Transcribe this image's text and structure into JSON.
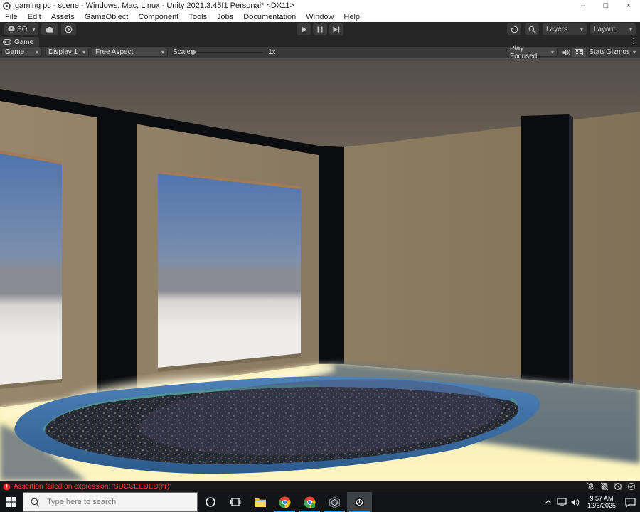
{
  "window": {
    "title": "gaming pc - scene - Windows, Mac, Linux - Unity 2021.3.45f1 Personal* <DX11>",
    "controls": {
      "minimize": "–",
      "maximize": "□",
      "close": "×"
    }
  },
  "glyphs": {
    "caret": "▾",
    "kebab": "⋮"
  },
  "menu_bar": {
    "items": [
      "File",
      "Edit",
      "Assets",
      "GameObject",
      "Component",
      "Tools",
      "Jobs",
      "Documentation",
      "Window",
      "Help"
    ]
  },
  "main_toolbar": {
    "account_label": "SO",
    "layers_label": "Layers",
    "layout_label": "Layout"
  },
  "game_panel": {
    "tab_label": "Game",
    "toolbar": {
      "view": "Game",
      "display": "Display 1",
      "aspect": "Free Aspect",
      "scale_label": "Scale",
      "scale_value": "1x",
      "play_focused": "Play Focused",
      "stats": "Stats",
      "gizmos": "Gizmos"
    }
  },
  "status_bar": {
    "error": "Assertion failed on expression: 'SUCCEEDED(hr)'"
  },
  "taskbar": {
    "search_placeholder": "Type here to search",
    "accent_underline": "#3f9bd8",
    "tray": {
      "time": "9:57 AM",
      "date": "12/5/2025"
    }
  },
  "scene": {
    "palette": {
      "ceiling_top": "#524e49",
      "ceiling_bottom": "#6a6054",
      "wall_left": "#97866a",
      "wall_left_dark": "#897961",
      "wall_right": "#8d7d61",
      "wall_right_dark": "#817158",
      "frame_black": "#0b0c10",
      "pillar_edge": "#23242c",
      "sky_top": "#4f74b0",
      "sky_mid": "#7b8fab",
      "horizon_gray": "#8a8b93",
      "ground_light": "#d8d6d3",
      "ground_white": "#edece8",
      "sill_orange": "#b07b45",
      "sill_shadow": "#6b5f49",
      "floor_yellow": "#f2e8a8",
      "floor_yellow_bright": "#fdf5c2",
      "floor_glow": "#fff8d2",
      "floor_shadow": "#717c82",
      "floor_shadow_dark": "#586a74",
      "pool_rim_light": "#4e82b8",
      "pool_rim_dark": "#2d5a8c",
      "pool_teal": "#4f998b",
      "water_dark": "#242a38",
      "water_tint": "#4a4460",
      "speck_gold": "#8f7c55",
      "speck_dim": "#665a40",
      "speck_blue": "#50506e"
    }
  }
}
